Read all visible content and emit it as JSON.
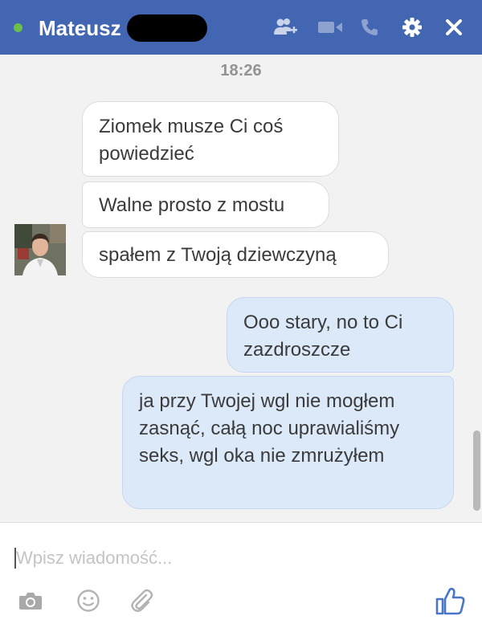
{
  "header": {
    "contact_name": "Mateusz",
    "status": "online",
    "icons": [
      "add-friend-icon",
      "video-call-icon",
      "phone-call-icon",
      "gear-icon",
      "close-icon"
    ]
  },
  "conversation": {
    "timestamp": "18:26",
    "messages": [
      {
        "direction": "incoming",
        "text": "Ziomek musze Ci coś powiedzieć"
      },
      {
        "direction": "incoming",
        "text": "Walne prosto z mostu"
      },
      {
        "direction": "incoming",
        "text": "spałem z Twoją dziewczyną"
      },
      {
        "direction": "outgoing",
        "text": "Ooo stary, no to Ci zazdroszcze"
      },
      {
        "direction": "outgoing",
        "text": "ja przy Twojej wgl nie mogłem zasnąć, całą noc uprawialiśmy seks, wgl oka nie zmrużyłem"
      }
    ]
  },
  "composer": {
    "placeholder": "Wpisz wiadomość...",
    "value": "",
    "icons": [
      "camera-icon",
      "emoji-icon",
      "attach-icon",
      "like-icon"
    ]
  },
  "colors": {
    "header_bg": "#4266b2",
    "online_dot": "#6cc04a",
    "chat_bg": "#f2f2f2",
    "incoming_bubble": "#ffffff",
    "outgoing_bubble": "#dce9f9",
    "like_blue": "#4a76c9"
  }
}
